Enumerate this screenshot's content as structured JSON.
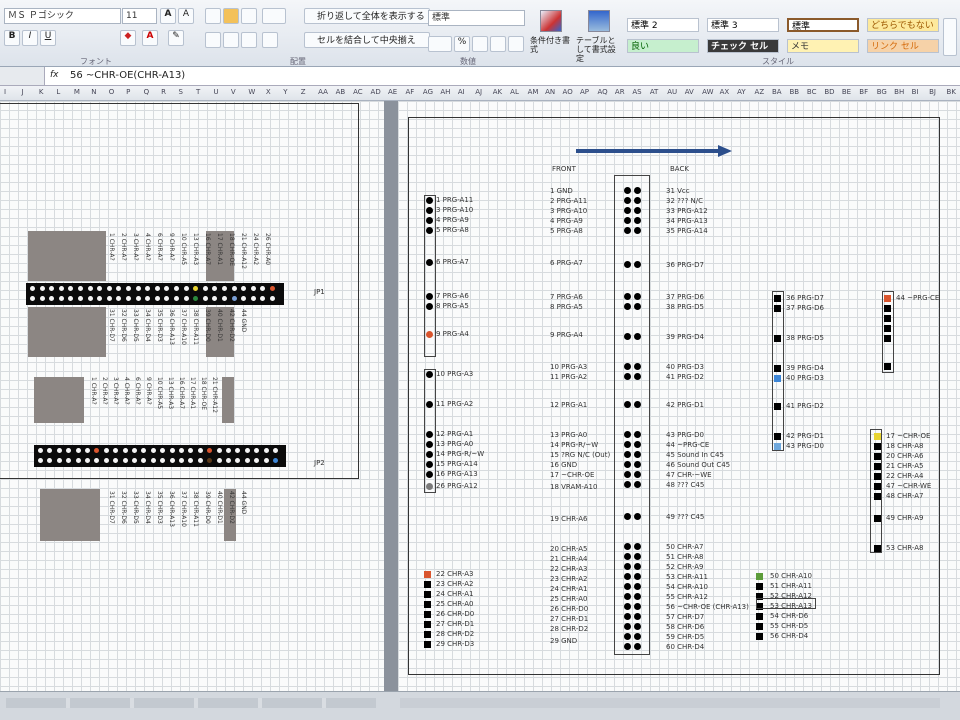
{
  "ribbon": {
    "font_name": "ＭＳ Ｐゴシック",
    "font_size": "11",
    "wrap_text": "折り返して全体を表示する",
    "merge_center": "セルを結合して中央揃え",
    "number_format": "標準",
    "cond_format": "条件付き書式",
    "table_format": "テーブルとして書式設定",
    "groups": {
      "font": "フォント",
      "align": "配置",
      "number": "数値",
      "style": "スタイル"
    },
    "styles": [
      "標準 2",
      "標準 3",
      "標準",
      "どちらでもない",
      "良い",
      "チェック セル",
      "メモ",
      "リンク セル"
    ]
  },
  "formula": {
    "fx": "fx",
    "value": "56 ~CHR-OE(CHR-A13)"
  },
  "columns": [
    "I",
    "J",
    "K",
    "L",
    "M",
    "N",
    "O",
    "P",
    "Q",
    "R",
    "S",
    "T",
    "U",
    "V",
    "W",
    "X",
    "Y",
    "Z",
    "AA",
    "AB",
    "AC",
    "AD",
    "AE",
    "AF",
    "AG",
    "AH",
    "AI",
    "AJ",
    "AK",
    "AL",
    "AM",
    "AN",
    "AO",
    "AP",
    "AQ",
    "AR",
    "AS",
    "AT",
    "AU",
    "AV",
    "AW",
    "AX",
    "AY",
    "AZ",
    "BA",
    "BB",
    "BC",
    "BD",
    "BE",
    "BF",
    "BG",
    "BH",
    "BI",
    "BJ",
    "BK"
  ],
  "left": {
    "jp1": "JP1",
    "jp2": "JP2",
    "pins_top": [
      "1 CHR-A?",
      "2 CHR-A?",
      "3 CHR-A?",
      "4 CHR-A?",
      "6 CHR-A?",
      "9 CHR-A?",
      "10 CHR-A5",
      "13 CHR-A3",
      "16 CHR-A7",
      "17 CHR-A1",
      "18 CHR-OE",
      "21 CHR-A12",
      "24 CHR-A2",
      "26 CHR-A0"
    ],
    "pins_bottom": [
      "31 CHR-D7",
      "32 CHR-D6",
      "33 CHR-D5",
      "34 CHR-D4",
      "35 CHR-D3",
      "36 CHR-A13",
      "37 CHR-A10",
      "38 CHR-A11",
      "39 CHR-D0",
      "40 CHR-D1",
      "42 CHR-D2",
      "44 GND"
    ]
  },
  "right": {
    "front_label": "FRONT",
    "back_label": "BACK",
    "col1": [
      "1 PRG-A11",
      "3 PRG-A10",
      "4 PRG-A9",
      "5 PRG-A8",
      "6 PRG-A7",
      "7 PRG-A6",
      "8 PRG-A5",
      "9 PRG-A4",
      "10 PRG-A3",
      "11 PRG-A2",
      "12 PRG-A1",
      "13 PRG-A0",
      "14 PRG-R/~W",
      "15 PRG-A14",
      "16 PRG-A13",
      "26 PRG-A12"
    ],
    "front": [
      "1 GND",
      "2 PRG-A11",
      "3 PRG-A10",
      "4 PRG-A9",
      "5 PRG-A8",
      "6 PRG-A7",
      "7 PRG-A6",
      "8 PRG-A5",
      "9 PRG-A4",
      "10 PRG-A3",
      "11 PRG-A2",
      "12 PRG-A1",
      "13 PRG-A0",
      "14 PRG-R/~W",
      "15 ?RG N/C (Out)",
      "16 GND",
      "17 ~CHR-OE",
      "18 VRAM-A10",
      "19 CHR-A6",
      "20 CHR-A5",
      "21 CHR-A4",
      "22 CHR-A3",
      "23 CHR-A2",
      "24 CHR-A1",
      "25 CHR-A0",
      "26 CHR-D0",
      "27 CHR-D1",
      "28 CHR-D2",
      "29 GND"
    ],
    "back": [
      "31 Vcc",
      "32 ??? N/C",
      "33 PRG-A12",
      "34 PRG-A13",
      "35 PRG-A14",
      "36 PRG-D7",
      "37 PRG-D6",
      "38 PRG-D5",
      "39 PRG-D4",
      "40 PRG-D3",
      "41 PRG-D2",
      "42 PRG-D1",
      "43 PRG-D0",
      "44 ~PRG-CE",
      "45 Sound In C45",
      "46 Sound Out C45",
      "47 CHR-~WE",
      "48 ??? C45",
      "49 ??? C45",
      "50 CHR-A7",
      "51 CHR-A8",
      "52 CHR-A9",
      "53 CHR-A11",
      "54 CHR-A10",
      "55 CHR-A12",
      "56 ~CHR-OE (CHR-A13)",
      "57 CHR-D7",
      "58 CHR-D6",
      "59 CHR-D5",
      "60 CHR-D4"
    ],
    "col3": [
      "36 PRG-D7",
      "37 PRG-D6",
      "38 PRG-D5",
      "39 PRG-D4",
      "40 PRG-D3",
      "41 PRG-D2",
      "42 PRG-D1",
      "43 PRG-D0"
    ],
    "col3b": [
      "50 CHR-A10",
      "51 CHR-A11",
      "52 CHR-A12",
      "53 CHR-A13",
      "54 CHR-D6",
      "55 CHR-D5",
      "56 CHR-D4"
    ],
    "col4": [
      "44 ~PRG-CE"
    ],
    "col4b": [
      "17 ~CHR-OE",
      "18 CHR-A8",
      "20 CHR-A6",
      "21 CHR-A5",
      "22 CHR-A4",
      "47 ~CHR-WE",
      "48 CHR-A7",
      "49 CHR-A9",
      "53 CHR-A8"
    ],
    "col1b": [
      "22 CHR-A3",
      "23 CHR-A2",
      "24 CHR-A1",
      "25 CHR-A0",
      "26 CHR-D0",
      "27 CHR-D1",
      "28 CHR-D2",
      "29 CHR-D3"
    ]
  },
  "colors": {
    "accent": "#3b5fa0",
    "pin": "#000000",
    "orange": "#d9552e",
    "yellow": "#e8d431",
    "blue": "#3d86d6"
  }
}
